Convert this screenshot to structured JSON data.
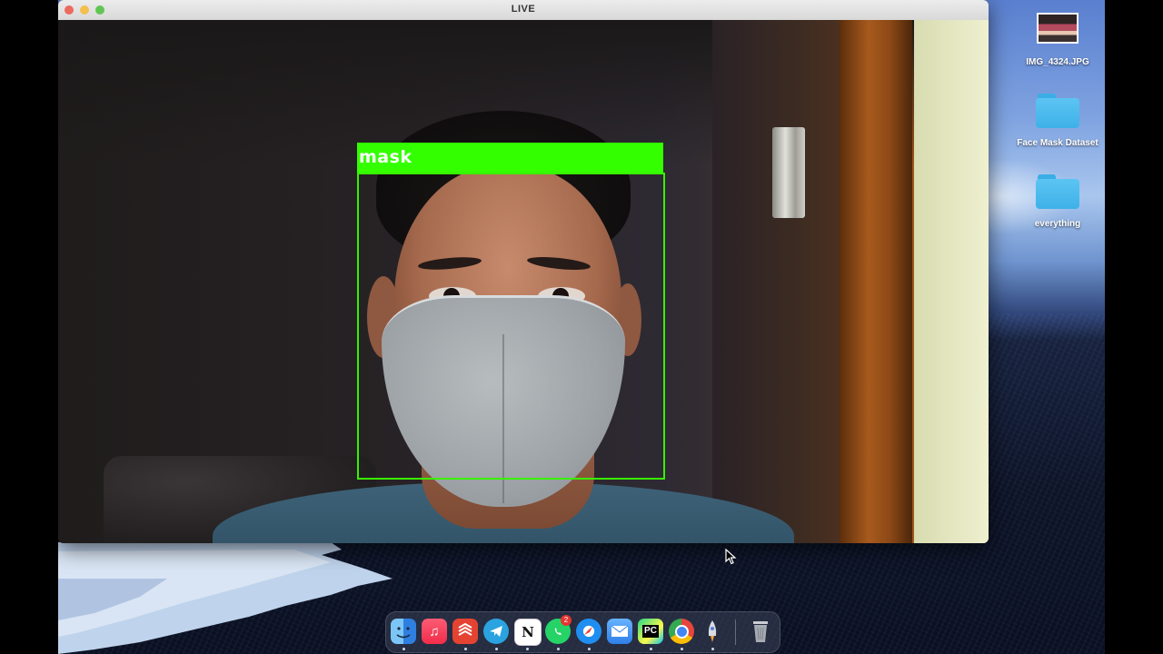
{
  "window": {
    "title": "LIVE"
  },
  "detection": {
    "label": "mask",
    "box_color": "#33ff00"
  },
  "desktop_items": [
    {
      "label": "IMG_4324.JPG",
      "icon": "image-file-icon"
    },
    {
      "label": "Face Mask Dataset",
      "icon": "folder-icon"
    },
    {
      "label": "everything",
      "icon": "folder-icon"
    }
  ],
  "dock": {
    "apps": [
      {
        "name": "Finder",
        "icon": "finder-icon",
        "color": "#3d8fe8"
      },
      {
        "name": "Music",
        "icon": "music-icon",
        "color": "#f53a55"
      },
      {
        "name": "Todoist",
        "icon": "todoist-icon",
        "color": "#e44332"
      },
      {
        "name": "Telegram",
        "icon": "telegram-icon",
        "color": "#2aa3e0"
      },
      {
        "name": "Notion",
        "icon": "notion-icon",
        "color": "#ffffff"
      },
      {
        "name": "WhatsApp",
        "icon": "whatsapp-icon",
        "color": "#25d366",
        "badge": "2"
      },
      {
        "name": "Safari",
        "icon": "safari-icon",
        "color": "#1f8ef0"
      },
      {
        "name": "Mail",
        "icon": "mail-icon",
        "color": "#3a86f0"
      },
      {
        "name": "PyCharm",
        "icon": "pycharm-icon",
        "color": "#21d789",
        "glyph": "PC"
      },
      {
        "name": "Chrome",
        "icon": "chrome-icon",
        "color": "#e8453c"
      },
      {
        "name": "Launchpad",
        "icon": "rocket-icon",
        "color": "#8a8f99"
      },
      {
        "name": "Trash",
        "icon": "trash-icon",
        "color": "#b8bcc2"
      }
    ]
  }
}
